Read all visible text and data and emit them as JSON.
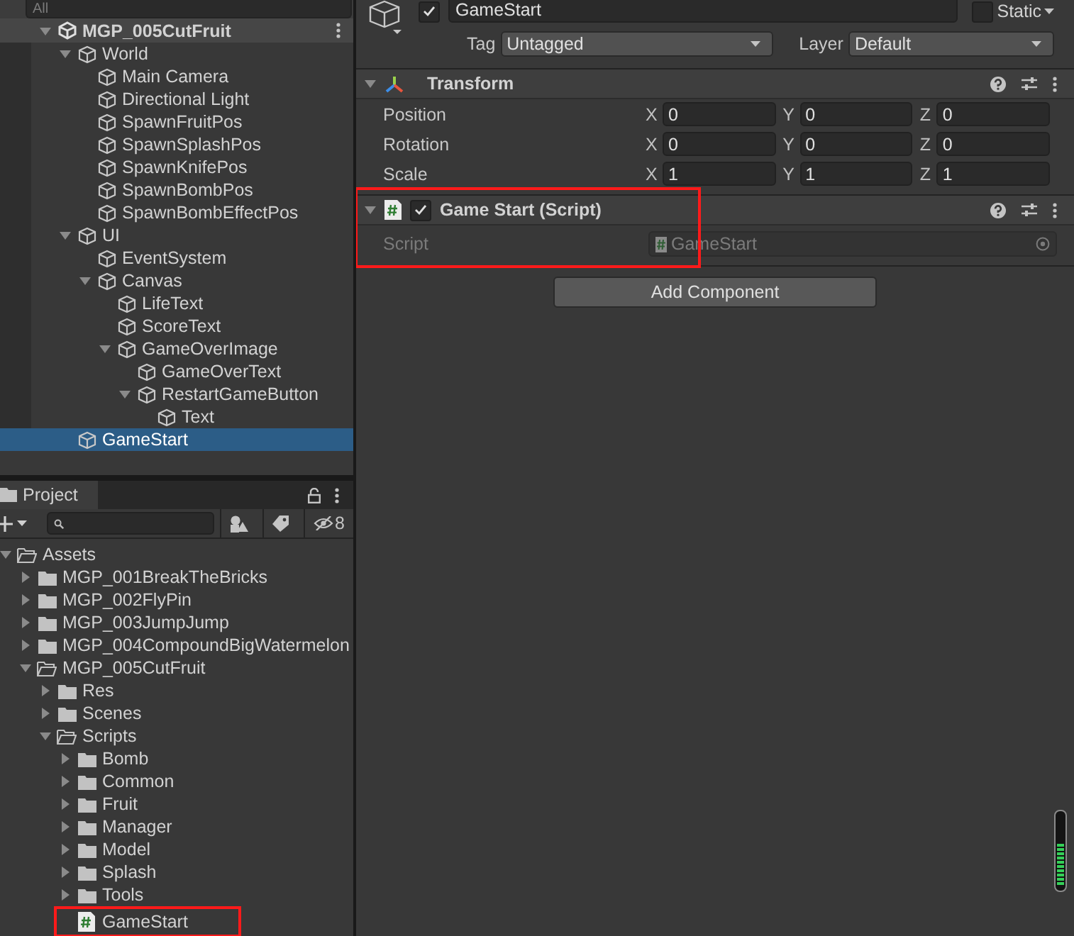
{
  "hierarchy": {
    "search": {
      "placeholder": "All"
    },
    "items": [
      {
        "name": "MGP_005CutFruit",
        "kind": "scene",
        "expanded": true,
        "selected": false,
        "children": [
          {
            "name": "World",
            "kind": "gameobject",
            "expanded": true,
            "selected": false,
            "children": [
              {
                "name": "Main Camera",
                "kind": "gameobject",
                "selected": false
              },
              {
                "name": "Directional Light",
                "kind": "gameobject",
                "selected": false
              },
              {
                "name": "SpawnFruitPos",
                "kind": "gameobject",
                "selected": false
              },
              {
                "name": "SpawnSplashPos",
                "kind": "gameobject",
                "selected": false
              },
              {
                "name": "SpawnKnifePos",
                "kind": "gameobject",
                "selected": false
              },
              {
                "name": "SpawnBombPos",
                "kind": "gameobject",
                "selected": false
              },
              {
                "name": "SpawnBombEffectPos",
                "kind": "gameobject",
                "selected": false
              }
            ]
          },
          {
            "name": "UI",
            "kind": "gameobject",
            "expanded": true,
            "selected": false,
            "children": [
              {
                "name": "EventSystem",
                "kind": "gameobject",
                "selected": false
              },
              {
                "name": "Canvas",
                "kind": "gameobject",
                "expanded": true,
                "selected": false,
                "children": [
                  {
                    "name": "LifeText",
                    "kind": "gameobject",
                    "selected": false
                  },
                  {
                    "name": "ScoreText",
                    "kind": "gameobject",
                    "selected": false
                  },
                  {
                    "name": "GameOverImage",
                    "kind": "gameobject",
                    "expanded": true,
                    "selected": false,
                    "children": [
                      {
                        "name": "GameOverText",
                        "kind": "gameobject",
                        "selected": false
                      },
                      {
                        "name": "RestartGameButton",
                        "kind": "gameobject",
                        "expanded": true,
                        "selected": false,
                        "children": [
                          {
                            "name": "Text",
                            "kind": "gameobject",
                            "selected": false
                          }
                        ]
                      }
                    ]
                  }
                ]
              }
            ]
          },
          {
            "name": "GameStart",
            "kind": "gameobject",
            "selected": true
          }
        ]
      }
    ]
  },
  "project": {
    "tab": "Project",
    "hidden_count": "8",
    "items": [
      {
        "name": "Assets",
        "kind": "folder",
        "expanded": true,
        "children": [
          {
            "name": "MGP_001BreakTheBricks",
            "kind": "folder",
            "expanded": false
          },
          {
            "name": "MGP_002FlyPin",
            "kind": "folder",
            "expanded": false
          },
          {
            "name": "MGP_003JumpJump",
            "kind": "folder",
            "expanded": false
          },
          {
            "name": "MGP_004CompoundBigWatermelon",
            "kind": "folder",
            "expanded": false
          },
          {
            "name": "MGP_005CutFruit",
            "kind": "folder",
            "expanded": true,
            "children": [
              {
                "name": "Res",
                "kind": "folder",
                "expanded": false
              },
              {
                "name": "Scenes",
                "kind": "folder",
                "expanded": false
              },
              {
                "name": "Scripts",
                "kind": "folder",
                "expanded": true,
                "children": [
                  {
                    "name": "Bomb",
                    "kind": "folder",
                    "expanded": false
                  },
                  {
                    "name": "Common",
                    "kind": "folder",
                    "expanded": false
                  },
                  {
                    "name": "Fruit",
                    "kind": "folder",
                    "expanded": false
                  },
                  {
                    "name": "Manager",
                    "kind": "folder",
                    "expanded": false
                  },
                  {
                    "name": "Model",
                    "kind": "folder",
                    "expanded": false
                  },
                  {
                    "name": "Splash",
                    "kind": "folder",
                    "expanded": false
                  },
                  {
                    "name": "Tools",
                    "kind": "folder",
                    "expanded": false
                  },
                  {
                    "name": "GameStart",
                    "kind": "script",
                    "highlighted": true
                  }
                ]
              }
            ]
          }
        ]
      }
    ]
  },
  "inspector": {
    "active": true,
    "name": "GameStart",
    "static": {
      "label": "Static",
      "checked": false
    },
    "tag": {
      "label": "Tag",
      "value": "Untagged"
    },
    "layer": {
      "label": "Layer",
      "value": "Default"
    },
    "components": [
      {
        "kind": "transform",
        "title": "Transform",
        "expanded": true,
        "rows": [
          {
            "label": "Position",
            "fields": [
              {
                "axis": "X",
                "value": "0"
              },
              {
                "axis": "Y",
                "value": "0"
              },
              {
                "axis": "Z",
                "value": "0"
              }
            ]
          },
          {
            "label": "Rotation",
            "fields": [
              {
                "axis": "X",
                "value": "0"
              },
              {
                "axis": "Y",
                "value": "0"
              },
              {
                "axis": "Z",
                "value": "0"
              }
            ]
          },
          {
            "label": "Scale",
            "fields": [
              {
                "axis": "X",
                "value": "1"
              },
              {
                "axis": "Y",
                "value": "1"
              },
              {
                "axis": "Z",
                "value": "1"
              }
            ]
          }
        ]
      },
      {
        "kind": "script",
        "title": "Game Start (Script)",
        "enabled": true,
        "expanded": true,
        "highlighted": true,
        "rows": [
          {
            "label": "Script",
            "value": "GameStart"
          }
        ]
      }
    ],
    "add_button": "Add Component",
    "audio_meter": {
      "level": 0.6
    }
  }
}
